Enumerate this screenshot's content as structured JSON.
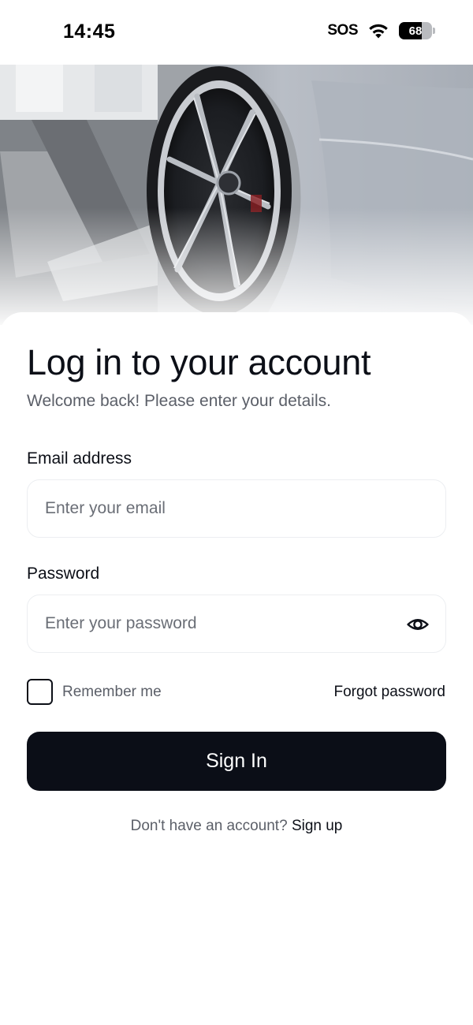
{
  "status_bar": {
    "time": "14:45",
    "sos": "SOS",
    "battery": "68",
    "battery_level": 0.68,
    "icons": [
      "wifi-icon",
      "battery-icon"
    ]
  },
  "hero": {
    "image": "car-wheel-photo"
  },
  "login": {
    "title": "Log in to your account",
    "subtitle": "Welcome back! Please enter your details.",
    "email_label": "Email address",
    "email_placeholder": "Enter your email",
    "email_value": "",
    "password_label": "Password",
    "password_placeholder": "Enter your password",
    "password_value": "",
    "password_toggle_icon": "eye-icon",
    "remember_label": "Remember me",
    "remember_checked": false,
    "forgot_label": "Forgot password",
    "signin_label": "Sign In",
    "signup_prompt": "Don't have an account?",
    "signup_link": "Sign up"
  },
  "colors": {
    "primary": "#0b0e17",
    "muted_text": "#5b5f68",
    "input_border": "#eceef1",
    "background": "#ffffff"
  }
}
